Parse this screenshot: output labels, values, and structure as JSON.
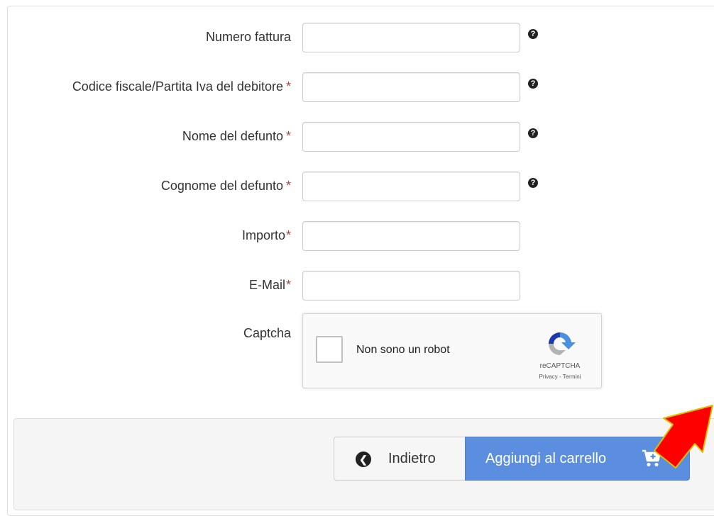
{
  "form": {
    "fields": [
      {
        "label": "Numero fattura",
        "required": "",
        "value": ""
      },
      {
        "label": "Codice fiscale/Partita Iva del debitore",
        "required": "*",
        "value": ""
      },
      {
        "label": "Nome del defunto",
        "required": "*",
        "value": ""
      },
      {
        "label": "Cognome del defunto",
        "required": "*",
        "value": ""
      },
      {
        "label": "Importo",
        "required": "*",
        "value": ""
      },
      {
        "label": "E-Mail",
        "required": "*",
        "value": ""
      }
    ],
    "help_glyph": "?",
    "captcha_label": "Captcha"
  },
  "captcha": {
    "checkbox_text": "Non sono un robot",
    "brand": "reCAPTCHA",
    "privacy": "Privacy",
    "separator": " - ",
    "terms": "Termini"
  },
  "actions": {
    "back_label": "Indietro",
    "add_label": "Aggiungi al carrello"
  },
  "colors": {
    "primary_button": "#5b8ede",
    "required_mark": "#a94442",
    "annotation_arrow": "#ff0000"
  }
}
